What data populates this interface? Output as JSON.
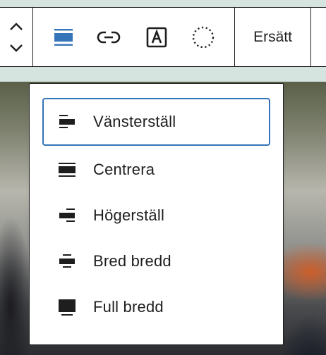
{
  "toolbar": {
    "move_handle_icon": "chevron-up-down-icon",
    "align_icon": "align-left-icon",
    "link_icon": "link-icon",
    "text_overlay_icon": "text-box-icon",
    "dotted_circle_icon": "dotted-circle-icon",
    "replace_label": "Ersätt",
    "accent_color": "#3474b8"
  },
  "align_menu": {
    "items": [
      {
        "label": "Vänsterställ",
        "icon": "align-left-icon",
        "selected": true
      },
      {
        "label": "Centrera",
        "icon": "align-center-icon",
        "selected": false
      },
      {
        "label": "Högerställ",
        "icon": "align-right-icon",
        "selected": false
      },
      {
        "label": "Bred bredd",
        "icon": "align-wide-icon",
        "selected": false
      },
      {
        "label": "Full bredd",
        "icon": "align-full-width-icon",
        "selected": false
      }
    ]
  }
}
